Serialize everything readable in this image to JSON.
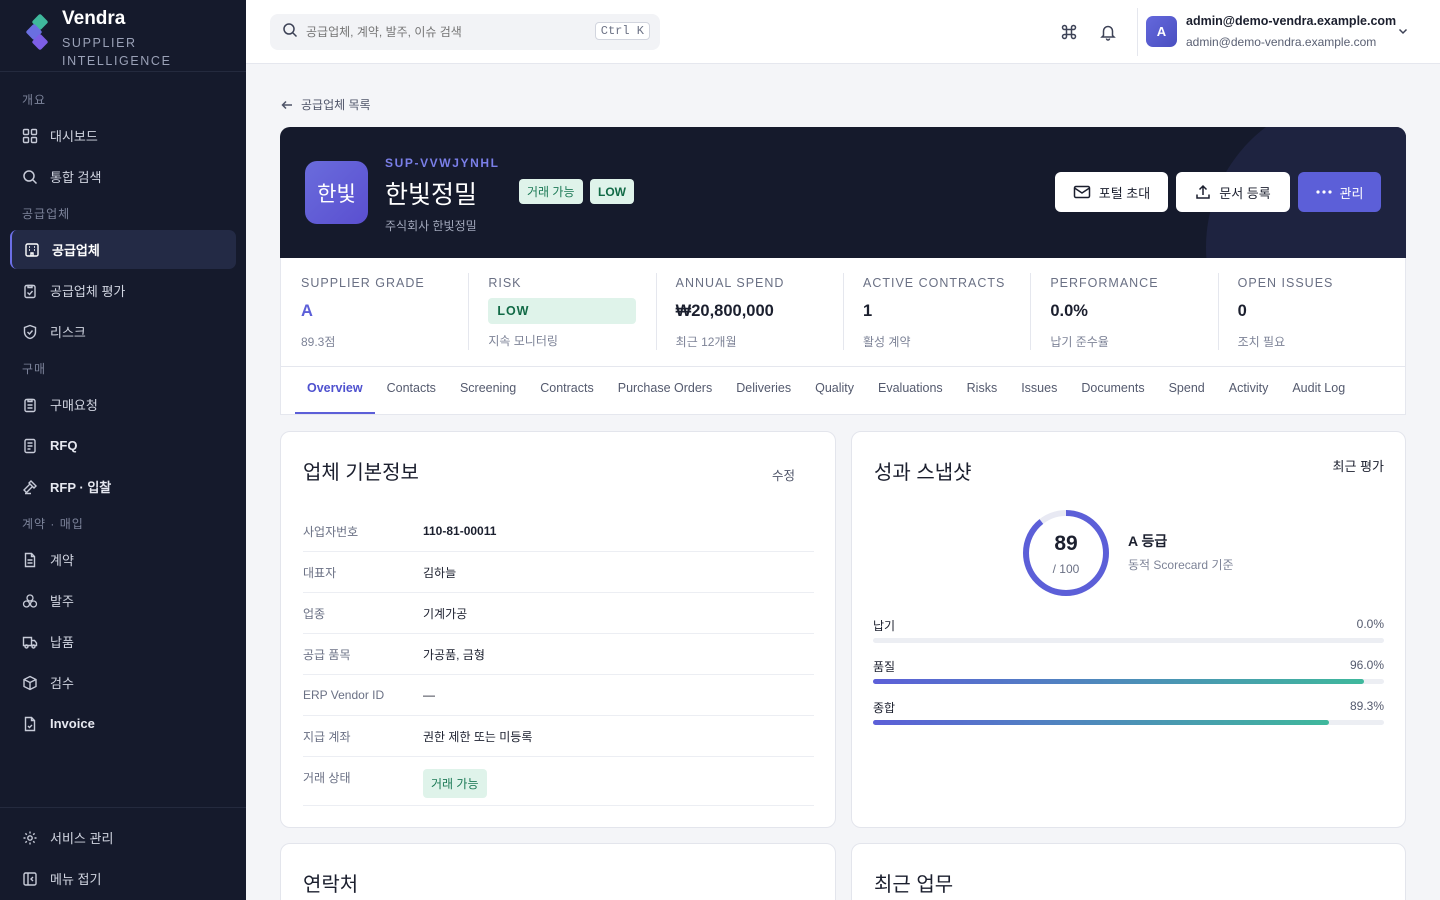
{
  "brand": {
    "name": "Vendra",
    "subtitle_line1": "SUPPLIER",
    "subtitle_line2": "INTELLIGENCE"
  },
  "sidebar": {
    "sections": [
      {
        "label": "개요",
        "items": [
          {
            "label": "대시보드",
            "icon": "grid-icon"
          },
          {
            "label": "통합 검색",
            "icon": "search-icon"
          }
        ]
      },
      {
        "label": "공급업체",
        "items": [
          {
            "label": "공급업체",
            "icon": "building-icon"
          },
          {
            "label": "공급업체 평가",
            "icon": "clipboard-check-icon"
          },
          {
            "label": "리스크",
            "icon": "shield-icon"
          }
        ]
      },
      {
        "label": "구매",
        "items": [
          {
            "label": "구매요청",
            "icon": "clipboard-icon"
          },
          {
            "label": "RFQ",
            "icon": "document-list-icon"
          },
          {
            "label": "RFP · 입찰",
            "icon": "gavel-icon"
          }
        ]
      },
      {
        "label": "계약 · 매입",
        "items": [
          {
            "label": "계약",
            "icon": "file-icon"
          },
          {
            "label": "발주",
            "icon": "boxes-icon"
          },
          {
            "label": "납품",
            "icon": "truck-icon"
          },
          {
            "label": "검수",
            "icon": "package-check-icon"
          },
          {
            "label": "Invoice",
            "icon": "receipt-icon"
          }
        ]
      }
    ],
    "bottom": [
      {
        "label": "서비스 관리",
        "icon": "gear-icon"
      },
      {
        "label": "메뉴 접기",
        "icon": "collapse-icon"
      }
    ]
  },
  "topbar": {
    "search_placeholder": "공급업체, 계약, 발주, 이슈 검색",
    "shortcut": "Ctrl K",
    "user_name": "admin@demo-vendra.example.com",
    "user_email": "admin@demo-vendra.example.com",
    "avatar_initial": "A"
  },
  "page": {
    "back_label": "공급업체 목록",
    "supplier": {
      "logo_text": "한빛",
      "code": "SUP-VVWJYNHL",
      "name": "한빛정밀",
      "legal_name": "주식회사 한빛정밀",
      "status_pill": "거래 가능",
      "risk_pill": "LOW"
    },
    "actions": {
      "invite": "포털 초대",
      "upload": "문서 등록",
      "manage": "관리"
    },
    "stats": [
      {
        "label": "SUPPLIER GRADE",
        "value": "A",
        "sub": "89.3점"
      },
      {
        "label": "RISK",
        "value": "LOW",
        "sub": "지속 모니터링"
      },
      {
        "label": "ANNUAL SPEND",
        "value": "₩20,800,000",
        "sub": "최근 12개월"
      },
      {
        "label": "ACTIVE CONTRACTS",
        "value": "1",
        "sub": "활성 계약"
      },
      {
        "label": "PERFORMANCE",
        "value": "0.0%",
        "sub": "납기 준수율"
      },
      {
        "label": "OPEN ISSUES",
        "value": "0",
        "sub": "조치 필요"
      }
    ],
    "tabs": [
      "Overview",
      "Contacts",
      "Screening",
      "Contracts",
      "Purchase Orders",
      "Deliveries",
      "Quality",
      "Evaluations",
      "Risks",
      "Issues",
      "Documents",
      "Spend",
      "Activity",
      "Audit Log"
    ]
  },
  "basic_info": {
    "title": "업체 기본정보",
    "edit": "수정",
    "rows": [
      {
        "key": "사업자번호",
        "value": "110-81-00011"
      },
      {
        "key": "대표자",
        "value": "김하늘"
      },
      {
        "key": "업종",
        "value": "기계가공"
      },
      {
        "key": "공급 품목",
        "value": "가공품, 금형"
      },
      {
        "key": "ERP Vendor ID",
        "value": "—"
      },
      {
        "key": "지급 계좌",
        "value": "권한 제한 또는 미등록"
      },
      {
        "key": "거래 상태",
        "value": "거래 가능"
      }
    ]
  },
  "performance": {
    "title": "성과 스냅샷",
    "link": "최근 평가",
    "score": "89",
    "score_max": "/ 100",
    "score_fraction": 0.893,
    "grade_label": "A 등급",
    "grade_desc": "동적 Scorecard 기준",
    "metrics": [
      {
        "label": "납기",
        "pct": "0.0%",
        "fraction": 0.0
      },
      {
        "label": "품질",
        "pct": "96.0%",
        "fraction": 0.96
      },
      {
        "label": "종합",
        "pct": "89.3%",
        "fraction": 0.893
      }
    ]
  },
  "contacts_card": {
    "title": "연락처"
  },
  "recent_card": {
    "title": "최근 업무"
  }
}
